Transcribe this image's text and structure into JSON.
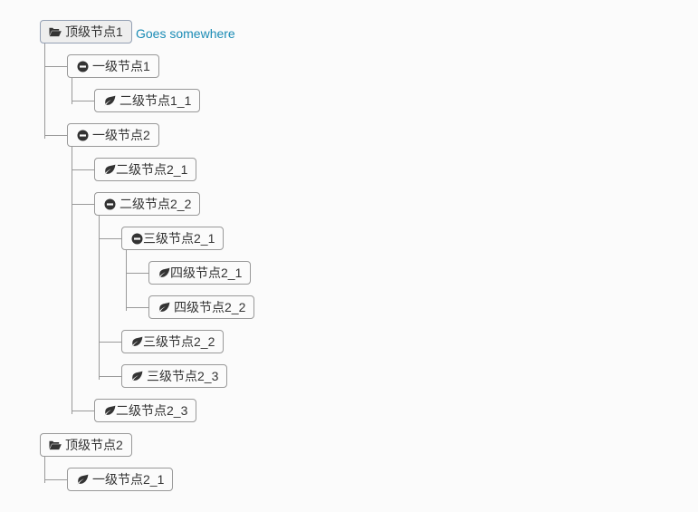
{
  "tree": {
    "link": {
      "label": "Goes somewhere",
      "color": "#1a8bb5"
    },
    "nodes": [
      {
        "label": "顶级节点1",
        "level": 0,
        "icon": "folder-open-icon",
        "iconGap": true,
        "active": true,
        "children": [
          {
            "label": "一级节点1",
            "level": 1,
            "icon": "minus-circle-icon",
            "iconGap": true,
            "children": [
              {
                "label": "二级节点1_1",
                "level": 2,
                "icon": "leaf-icon",
                "iconGap": true,
                "children": []
              }
            ]
          },
          {
            "label": "一级节点2",
            "level": 1,
            "icon": "minus-circle-icon",
            "iconGap": true,
            "children": [
              {
                "label": "二级节点2_1",
                "level": 2,
                "icon": "leaf-icon",
                "iconGap": false,
                "children": []
              },
              {
                "label": "二级节点2_2",
                "level": 2,
                "icon": "minus-circle-icon",
                "iconGap": true,
                "children": [
                  {
                    "label": "三级节点2_1",
                    "level": 3,
                    "icon": "minus-circle-icon",
                    "iconGap": false,
                    "children": [
                      {
                        "label": "四级节点2_1",
                        "level": 4,
                        "icon": "leaf-icon",
                        "iconGap": false,
                        "children": []
                      },
                      {
                        "label": "四级节点2_2",
                        "level": 4,
                        "icon": "leaf-icon",
                        "iconGap": true,
                        "children": []
                      }
                    ]
                  },
                  {
                    "label": "三级节点2_2",
                    "level": 3,
                    "icon": "leaf-icon",
                    "iconGap": false,
                    "children": []
                  },
                  {
                    "label": "三级节点2_3",
                    "level": 3,
                    "icon": "leaf-icon",
                    "iconGap": true,
                    "children": []
                  }
                ]
              },
              {
                "label": "二级节点2_3",
                "level": 2,
                "icon": "leaf-icon",
                "iconGap": false,
                "children": []
              }
            ]
          }
        ]
      },
      {
        "label": "顶级节点2",
        "level": 0,
        "icon": "folder-open-icon",
        "iconGap": true,
        "active": false,
        "children": [
          {
            "label": "一级节点2_1",
            "level": 1,
            "icon": "leaf-icon",
            "iconGap": true,
            "children": []
          }
        ]
      }
    ]
  }
}
